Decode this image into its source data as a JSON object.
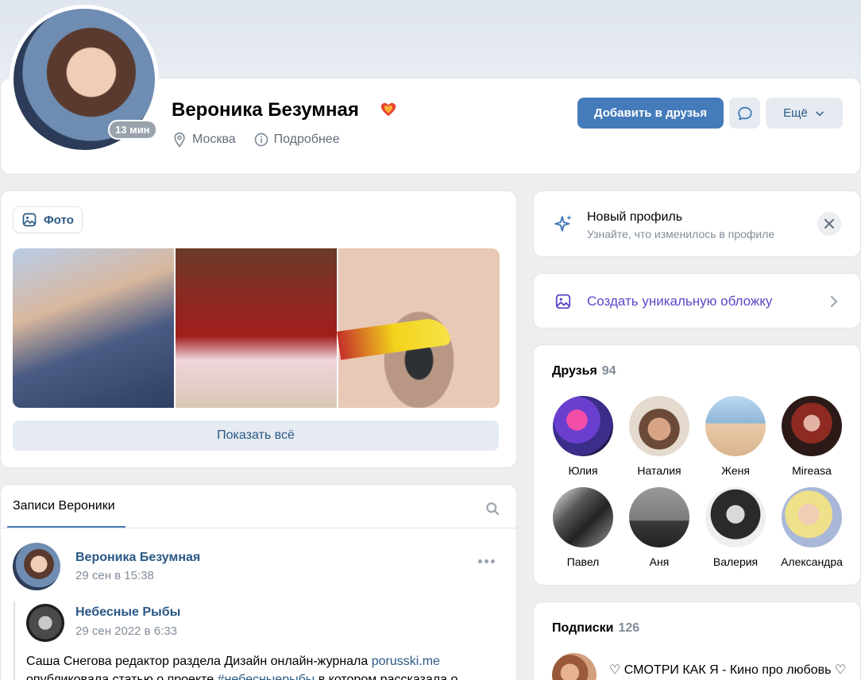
{
  "profile": {
    "name": "Вероника Безумная",
    "online_badge": "13 мин",
    "city": "Москва",
    "details_label": "Подробнее",
    "add_friend_label": "Добавить в друзья",
    "more_label": "Ещё"
  },
  "photos": {
    "tab_label": "Фото",
    "show_all_label": "Показать всё"
  },
  "posts": {
    "tab_label": "Записи Вероники",
    "post": {
      "author": "Вероника Безумная",
      "date": "29 сен в 15:38",
      "repost_author": "Небесные Рыбы",
      "repost_date": "29 сен 2022 в 6:33",
      "text_part1": "Саша Снегова редактор раздела Дизайн онлайн-журнала ",
      "text_link1": "porusski.me",
      "text_part2": "опубликовала статью о проекте ",
      "text_link2": "#небесныерыбы",
      "text_part3": " в котором рассказала о"
    }
  },
  "new_profile": {
    "title": "Новый профиль",
    "subtitle": "Узнайте, что изменилось в профиле"
  },
  "cover": {
    "label": "Создать уникальную обложку"
  },
  "friends": {
    "title": "Друзья",
    "count": "94",
    "items": [
      {
        "name": "Юлия"
      },
      {
        "name": "Наталия"
      },
      {
        "name": "Женя"
      },
      {
        "name": "Mireasa"
      },
      {
        "name": "Павел"
      },
      {
        "name": "Аня"
      },
      {
        "name": "Валерия"
      },
      {
        "name": "Александра"
      }
    ]
  },
  "subscriptions": {
    "title": "Подписки",
    "count": "126",
    "first_item": "♡ СМОТРИ КАК Я - Кино про любовь ♡"
  },
  "colors": {
    "accent": "#447bba",
    "link": "#2a5885",
    "purple": "#5b47c7"
  }
}
